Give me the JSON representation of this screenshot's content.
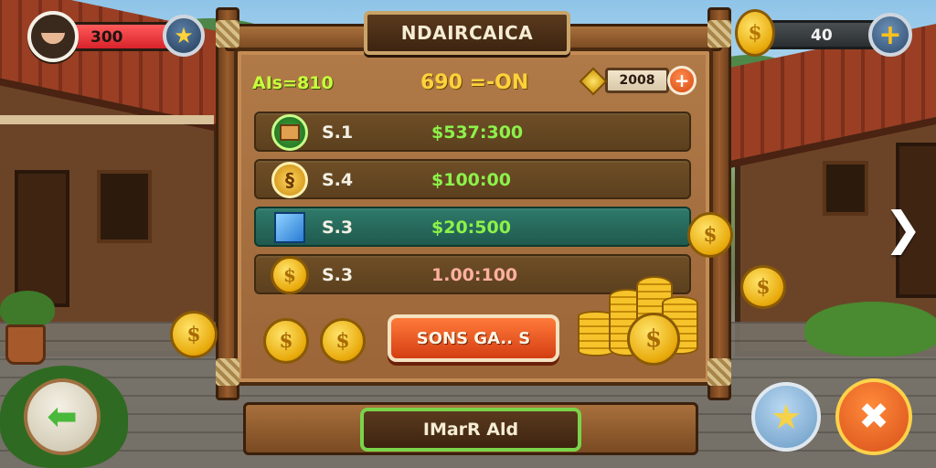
{
  "hud": {
    "player_value": "300",
    "star_icon": "star-icon",
    "coins": "40",
    "coin_symbol": "$",
    "plus_symbol": "+"
  },
  "panel": {
    "title": "NDAIRCAICA",
    "label_left": "AIs=810",
    "label_mid": "690 =-ON",
    "currency_value": "2008",
    "plus_symbol": "+"
  },
  "rows": [
    {
      "icon": "box-icon",
      "tier": "S.1",
      "price": "$537:300"
    },
    {
      "icon": "key-icon",
      "tier": "S.4",
      "price": "$100:00"
    },
    {
      "icon": "cube-icon",
      "tier": "S.3",
      "price": "$20:500"
    },
    {
      "icon": "coin-icon",
      "tier": "S.3",
      "price": "1.00:100"
    }
  ],
  "coin_glyph": "$",
  "action_button": "SONS GA.. S",
  "bottom_button": "IMarR Ald",
  "nav": {
    "back_arrow": "⬅",
    "star": "★",
    "close": "✖",
    "next": "❯"
  },
  "colors": {
    "accent_orange": "#d43e12",
    "highlight_teal": "#2f7a6a",
    "price_green": "#8cf24a",
    "gold": "#e8a90a"
  }
}
